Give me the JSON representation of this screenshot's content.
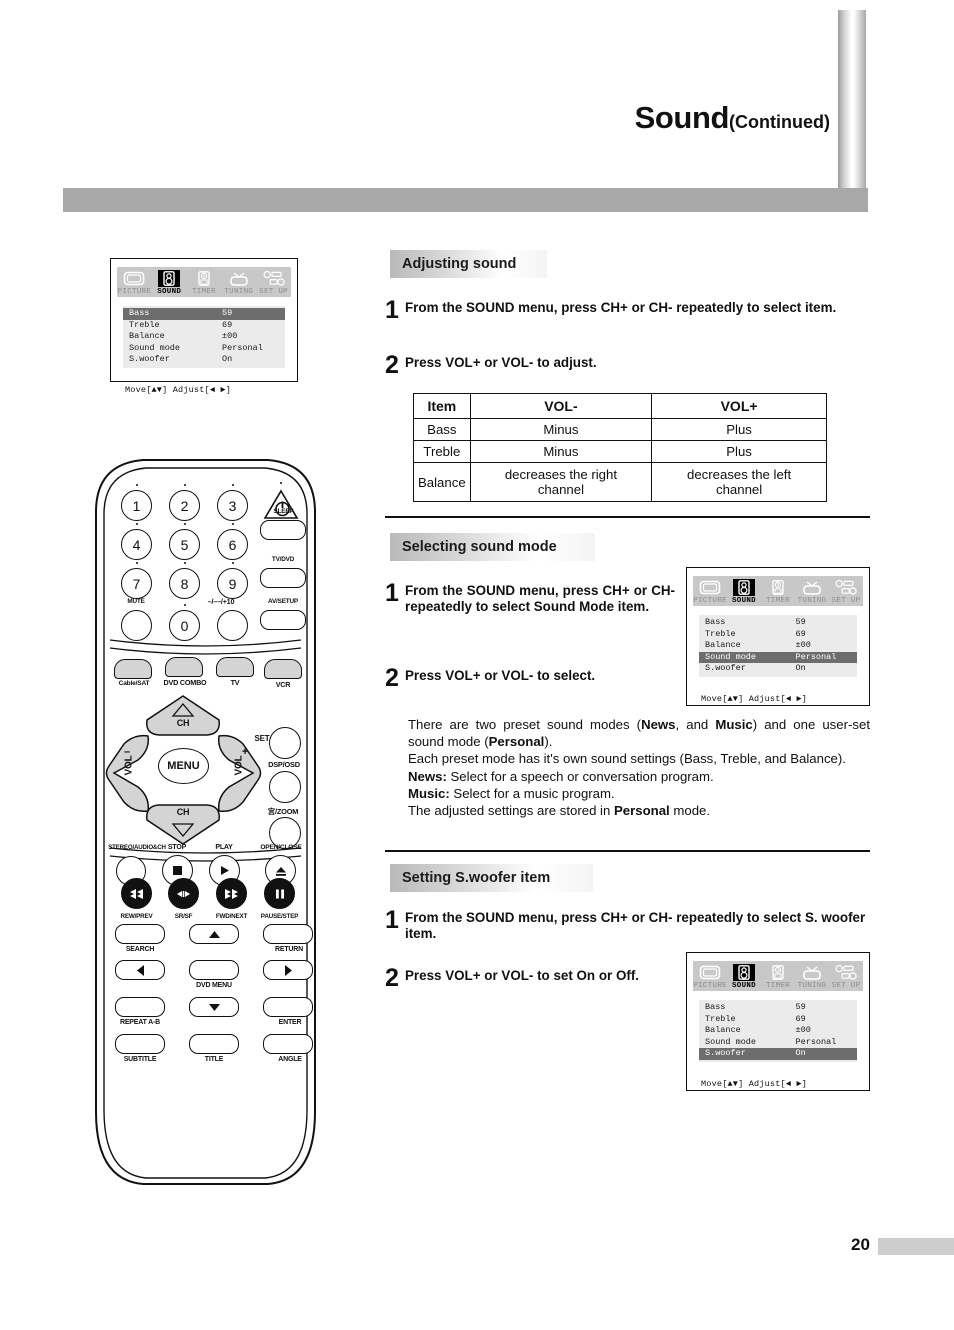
{
  "header": {
    "title": "Sound",
    "title_suffix": "(Continued)"
  },
  "page_number": "20",
  "osd": {
    "tabs": [
      {
        "label": "PICTURE",
        "icon": "tv-screen-icon",
        "selected": false
      },
      {
        "label": "SOUND",
        "icon": "speaker-icon",
        "selected": true
      },
      {
        "label": "TIMER",
        "icon": "clock-icon",
        "selected": false
      },
      {
        "label": "TUNING",
        "icon": "antenna-tv-icon",
        "selected": false
      },
      {
        "label": "SET UP",
        "icon": "setup-icon",
        "selected": false
      }
    ],
    "rows": [
      {
        "key": "Bass",
        "value": "59"
      },
      {
        "key": "Treble",
        "value": "69"
      },
      {
        "key": "Balance",
        "value": "±00"
      },
      {
        "key": "Sound mode",
        "value": "Personal"
      },
      {
        "key": "S.woofer",
        "value": "On"
      }
    ],
    "footer": "Move[▲▼]  Adjust[◄ ►]",
    "highlight_1": "Bass",
    "highlight_2": "Sound mode",
    "highlight_3": "S.woofer"
  },
  "remote": {
    "numbers": [
      "1",
      "2",
      "3",
      "4",
      "5",
      "6",
      "7",
      "8",
      "9",
      "0"
    ],
    "power": "power-icon",
    "labels": {
      "sleep": "SLEEP",
      "tvdvd": "TV/DVD",
      "mute": "MUTE",
      "plus10": "–/––/+10",
      "avsetup": "AV/SETUP",
      "cablesat": "Cable/SAT",
      "dvdcombo": "DVD COMBO",
      "tv": "TV",
      "vcr": "VCR",
      "set": "SET",
      "dsposd": "DSP/OSD",
      "zoom": "宫/ZOOM",
      "chup": "CH",
      "chdn": "CH",
      "volminus": "VOL",
      "volplus": "VOL",
      "menu": "MENU",
      "stereo": "STEREO/AUDIO&CH",
      "stop": "STOP",
      "play": "PLAY",
      "openclose": "OPEN/CLOSE",
      "rewprev": "REW/PREV",
      "srsf": "SR/SF",
      "fwdnext": "FWD/NEXT",
      "pausestep": "PAUSE/STEP",
      "search": "SEARCH",
      "return": "RETURN",
      "dvdmenu": "DVD MENU",
      "repeat": "REPEAT A-B",
      "enter": "ENTER",
      "subtitle": "SUBTITLE",
      "title": "TITLE",
      "angle": "ANGLE"
    }
  },
  "sections": {
    "adjusting": {
      "heading": "Adjusting sound",
      "step1_num": "1",
      "step1_text": "From the SOUND menu, press CH+ or CH- repeatedly to select item.",
      "step2_num": "2",
      "step2_text": "Press VOL+ or VOL- to adjust.",
      "table": {
        "headers": [
          "Item",
          "VOL-",
          "VOL+"
        ],
        "rows": [
          [
            "Bass",
            "Minus",
            "Plus"
          ],
          [
            "Treble",
            "Minus",
            "Plus"
          ],
          [
            "Balance",
            "decreases the right channel",
            "decreases the left channel"
          ]
        ]
      }
    },
    "selecting": {
      "heading": "Selecting sound mode",
      "step1_num": "1",
      "step1_text": "From the SOUND menu, press CH+ or CH- repeatedly to select Sound Mode item.",
      "step2_num": "2",
      "step2_text": "Press VOL+ or VOL- to select.",
      "para_line1_a": "There are two preset sound modes (",
      "para_news": "News",
      "para_line1_b": ", and ",
      "para_music": "Music",
      "para_line1_c": ")  and one user-set sound mode (",
      "para_personal": "Personal",
      "para_line1_d": ").",
      "para_line2": "Each preset mode has it's own sound settings (Bass, Treble, and Balance).",
      "news_label": "News:",
      "news_text": " Select for a speech or conversation program.",
      "music_label": "Music:",
      "music_text": " Select for a music program.",
      "stored_a": "The adjusted settings are stored in ",
      "stored_b": "Personal",
      "stored_c": " mode."
    },
    "swoofer": {
      "heading": "Setting S.woofer item",
      "step1_num": "1",
      "step1_text": "From the SOUND menu, press CH+ or CH- repeatedly to select S. woofer item.",
      "step2_num": "2",
      "step2_text": "Press VOL+ or VOL- to set On or Off."
    }
  }
}
